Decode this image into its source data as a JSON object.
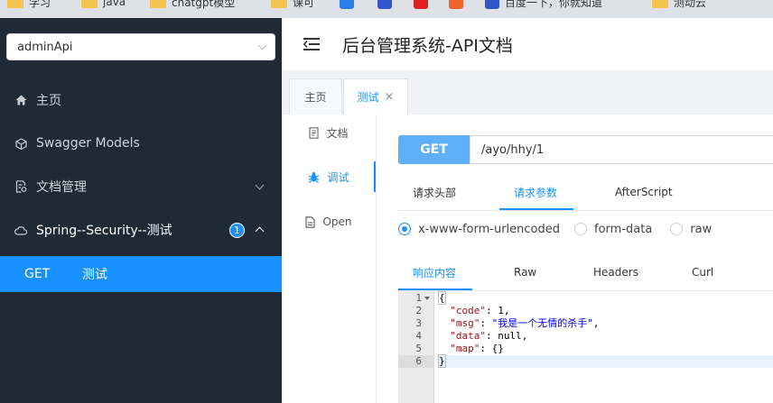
{
  "bookmarks": [
    "学习",
    "java",
    "chatgpt模型",
    "课可",
    "百度一下，你就知道",
    "测动云"
  ],
  "sidebar": {
    "select_value": "adminApi",
    "items": [
      {
        "label": "主页"
      },
      {
        "label": "Swagger Models"
      },
      {
        "label": "文档管理"
      },
      {
        "label": "Spring--Security--测试",
        "badge": "1"
      }
    ],
    "sub_item": {
      "method": "GET",
      "label": "测试"
    }
  },
  "header": {
    "title": "后台管理系统-API文档"
  },
  "tabs": [
    {
      "label": "主页"
    },
    {
      "label": "测试",
      "close": "×"
    }
  ],
  "vtabs": [
    {
      "label": "文档"
    },
    {
      "label": "调试"
    },
    {
      "label": "Open"
    }
  ],
  "request": {
    "method": "GET",
    "url": "/ayo/hhy/1",
    "tabs": [
      "请求头部",
      "请求参数",
      "AfterScript"
    ],
    "body_types": [
      "x-www-form-urlencoded",
      "form-data",
      "raw"
    ]
  },
  "response": {
    "tabs": [
      "响应内容",
      "Raw",
      "Headers",
      "Curl"
    ],
    "line_numbers": [
      "1",
      "2",
      "3",
      "4",
      "5",
      "6"
    ],
    "lines": [
      {
        "parts": [
          "{"
        ]
      },
      {
        "key": "\"code\"",
        "sep": ": ",
        "val": "1",
        "tail": ","
      },
      {
        "key": "\"msg\"",
        "sep": ": ",
        "val": "\"我是一个无情的杀手\"",
        "tail": ","
      },
      {
        "key": "\"data\"",
        "sep": ": ",
        "val": "null",
        "tail": ","
      },
      {
        "key": "\"map\"",
        "sep": ": ",
        "val": "{}",
        "tail": ""
      },
      {
        "parts": [
          "}"
        ]
      }
    ]
  },
  "colors": {
    "accent": "#1890ff",
    "sidebar_bg": "#1f2a34",
    "method_btn": "#5fb0fb"
  }
}
